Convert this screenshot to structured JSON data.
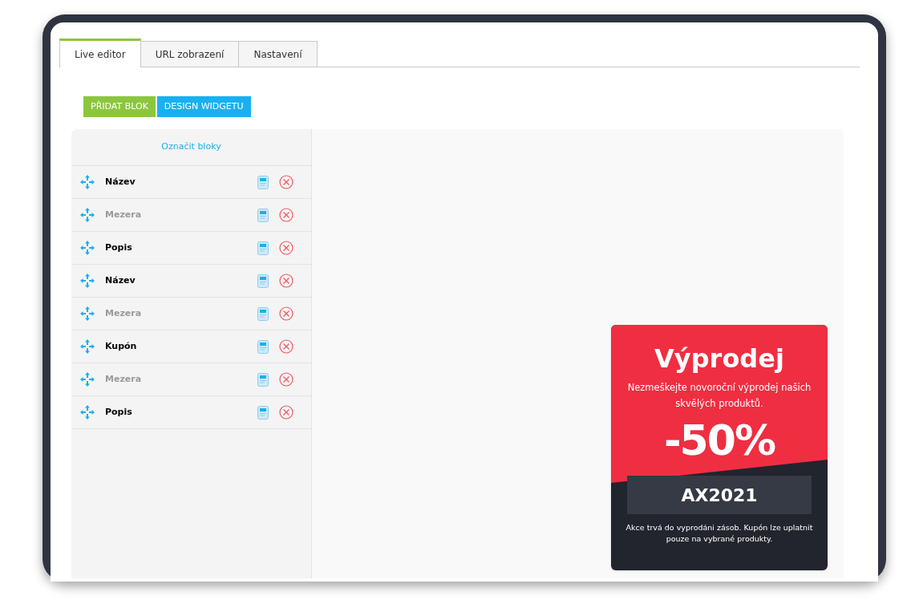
{
  "tabs": [
    {
      "label": "Live editor",
      "selected": true
    },
    {
      "label": "URL zobrazení",
      "selected": false
    },
    {
      "label": "Nastavení",
      "selected": false
    }
  ],
  "toolbar": {
    "add_button": "PŘIDAT BLOK",
    "design_button": "DESIGN WIDGETU"
  },
  "blocks_panel": {
    "select_link": "Označit bloky",
    "blocks": [
      {
        "label": "Název",
        "kind": "content"
      },
      {
        "label": "Mezera",
        "kind": "spacer"
      },
      {
        "label": "Popis",
        "kind": "content"
      },
      {
        "label": "Název",
        "kind": "content"
      },
      {
        "label": "Mezera",
        "kind": "spacer"
      },
      {
        "label": "Kupón",
        "kind": "content"
      },
      {
        "label": "Mezera",
        "kind": "spacer"
      },
      {
        "label": "Popis",
        "kind": "content"
      }
    ]
  },
  "widget": {
    "title": "Výprodej",
    "subtitle": "Nezmeškejte novoroční výprodej našich skvělých produktů.",
    "discount": "-50%",
    "coupon_code": "AX2021",
    "footnote": "Akce trvá do vyprodáni zásob. Kupón lze uplatnit pouze na vybrané produkty."
  }
}
